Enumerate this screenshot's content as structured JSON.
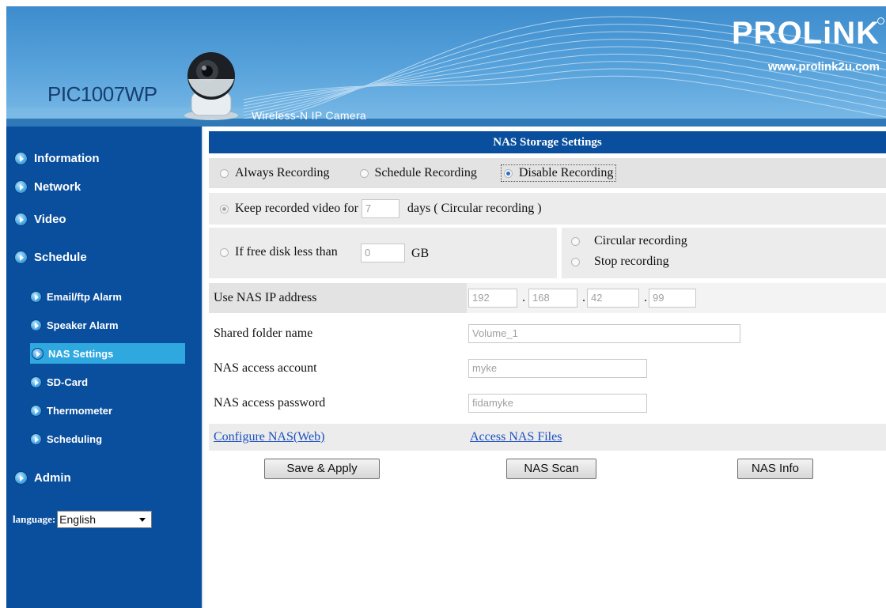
{
  "header": {
    "model": "PIC1007WP",
    "tagline": "Wireless-N IP Camera",
    "brand": "PROLiNK",
    "url": "www.prolink2u.com"
  },
  "sidebar": {
    "items": [
      {
        "label": "Information"
      },
      {
        "label": "Network"
      },
      {
        "label": "Video"
      },
      {
        "label": "Schedule"
      },
      {
        "label": "Email/ftp Alarm"
      },
      {
        "label": "Speaker Alarm"
      },
      {
        "label": "NAS Settings",
        "active": true
      },
      {
        "label": "SD-Card"
      },
      {
        "label": "Thermometer"
      },
      {
        "label": "Scheduling"
      },
      {
        "label": "Admin"
      }
    ],
    "language_label": "language:",
    "language_value": "English"
  },
  "content": {
    "title": "NAS Storage Settings",
    "recording_modes": [
      {
        "label": "Always Recording",
        "checked": false
      },
      {
        "label": "Schedule Recording",
        "checked": false
      },
      {
        "label": "Disable Recording",
        "checked": true
      }
    ],
    "keep_label": "Keep recorded video for",
    "keep_days": "7",
    "keep_suffix": "days ( Circular recording )",
    "free_label": "If free disk less than",
    "free_gb": "0",
    "free_unit": "GB",
    "full_options": [
      "Circular recording",
      "Stop recording"
    ],
    "nas_ip_label": "Use NAS IP address",
    "nas_ip": [
      "192",
      "168",
      "42",
      "99"
    ],
    "ip_dot": ".",
    "shared_folder_label": "Shared folder name",
    "shared_folder": "Volume_1",
    "account_label": "NAS access account",
    "account": "myke",
    "password_label": "NAS access password",
    "password": "fidamyke",
    "configure_link": "Configure NAS(Web)",
    "access_link": "Access NAS Files",
    "buttons": {
      "save": "Save & Apply",
      "scan": "NAS Scan",
      "info": "NAS Info"
    }
  },
  "colors": {
    "nav_bg": "#0a4f9e",
    "nav_active": "#2fa8e0",
    "header_blue": "#4a98d6",
    "link": "#1a4fbf"
  }
}
